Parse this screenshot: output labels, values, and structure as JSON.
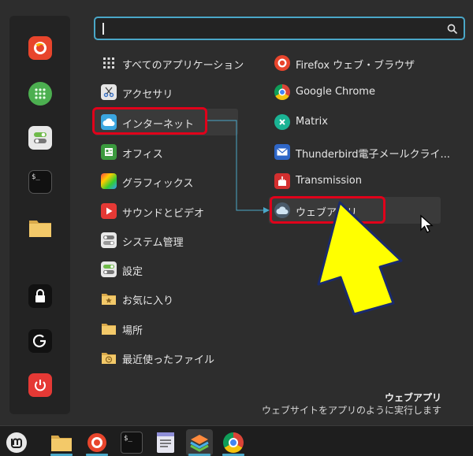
{
  "search": {
    "value": "",
    "placeholder": ""
  },
  "favorites": [
    {
      "icon": "firefox-icon"
    },
    {
      "icon": "calculator-icon"
    },
    {
      "icon": "settings-toggle-icon"
    },
    {
      "icon": "terminal-icon",
      "text": "$_"
    },
    {
      "icon": "folder-icon"
    },
    {
      "icon": "lock-icon"
    },
    {
      "icon": "logout-icon"
    },
    {
      "icon": "power-icon"
    }
  ],
  "categories": [
    {
      "label": "すべてのアプリケーション",
      "icon": "grid-icon"
    },
    {
      "label": "アクセサリ",
      "icon": "scissors-icon"
    },
    {
      "label": "インターネット",
      "icon": "cloud-icon"
    },
    {
      "label": "オフィス",
      "icon": "office-icon"
    },
    {
      "label": "グラフィックス",
      "icon": "graphics-icon"
    },
    {
      "label": "サウンドとビデオ",
      "icon": "play-icon"
    },
    {
      "label": "システム管理",
      "icon": "system-icon"
    },
    {
      "label": "設定",
      "icon": "settings-icon"
    },
    {
      "label": "お気に入り",
      "icon": "favorites-folder-icon"
    },
    {
      "label": "場所",
      "icon": "places-folder-icon"
    },
    {
      "label": "最近使ったファイル",
      "icon": "recent-folder-icon"
    }
  ],
  "apps": [
    {
      "label": "Firefox ウェブ・ブラウザ",
      "icon": "firefox-icon"
    },
    {
      "label": "Google Chrome",
      "icon": "chrome-icon"
    },
    {
      "label": "Matrix",
      "icon": "matrix-icon"
    },
    {
      "label": "Thunderbird電子メールクライ...",
      "icon": "thunderbird-icon"
    },
    {
      "label": "Transmission",
      "icon": "transmission-icon"
    },
    {
      "label": "ウェブアプリ",
      "icon": "webapp-icon"
    }
  ],
  "description": {
    "title": "ウェブアプリ",
    "text": "ウェブサイトをアプリのように実行します"
  },
  "taskbar": [
    {
      "icon": "mint-menu-icon"
    },
    {
      "icon": "folder-icon"
    },
    {
      "icon": "firefox-icon"
    },
    {
      "icon": "terminal-icon",
      "text": "$_"
    },
    {
      "icon": "text-editor-icon"
    },
    {
      "icon": "layers-icon"
    },
    {
      "icon": "chrome-icon"
    }
  ],
  "colors": {
    "accent": "#4aa7c8",
    "highlight_box": "#e0001a",
    "arrow_fill": "#ffff00",
    "arrow_stroke": "#1a2a6c"
  }
}
